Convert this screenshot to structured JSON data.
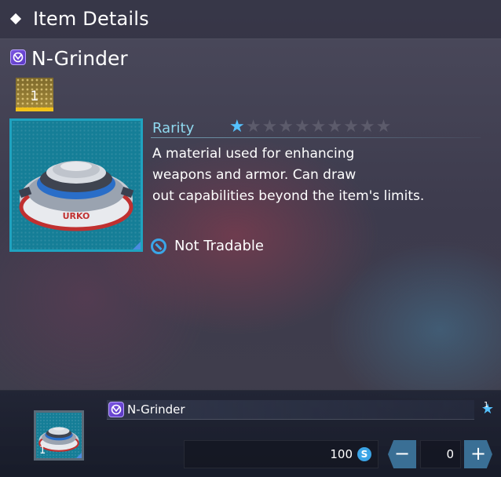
{
  "header": {
    "title": "Item Details"
  },
  "item": {
    "name": "N-Grinder",
    "quantity": "1",
    "rarity_label": "Rarity",
    "rarity_stars": 1,
    "rarity_max": 10,
    "description_lines": [
      "A material used for enhancing",
      "weapons and armor. Can draw",
      "out capabilities beyond the item's limits."
    ],
    "tradable_text": "Not Tradable"
  },
  "footer": {
    "item_name": "N-Grinder",
    "thumb_quantity": "1",
    "rarity_badge": "1",
    "price": "100",
    "currency_icon": "S",
    "quantity_value": "0",
    "minus_label": "−",
    "plus_label": "+"
  },
  "colors": {
    "rarity_star": "#55c2ff",
    "tradable_icon": "#3aa6e8",
    "qty_bar": "#f2c21a"
  }
}
